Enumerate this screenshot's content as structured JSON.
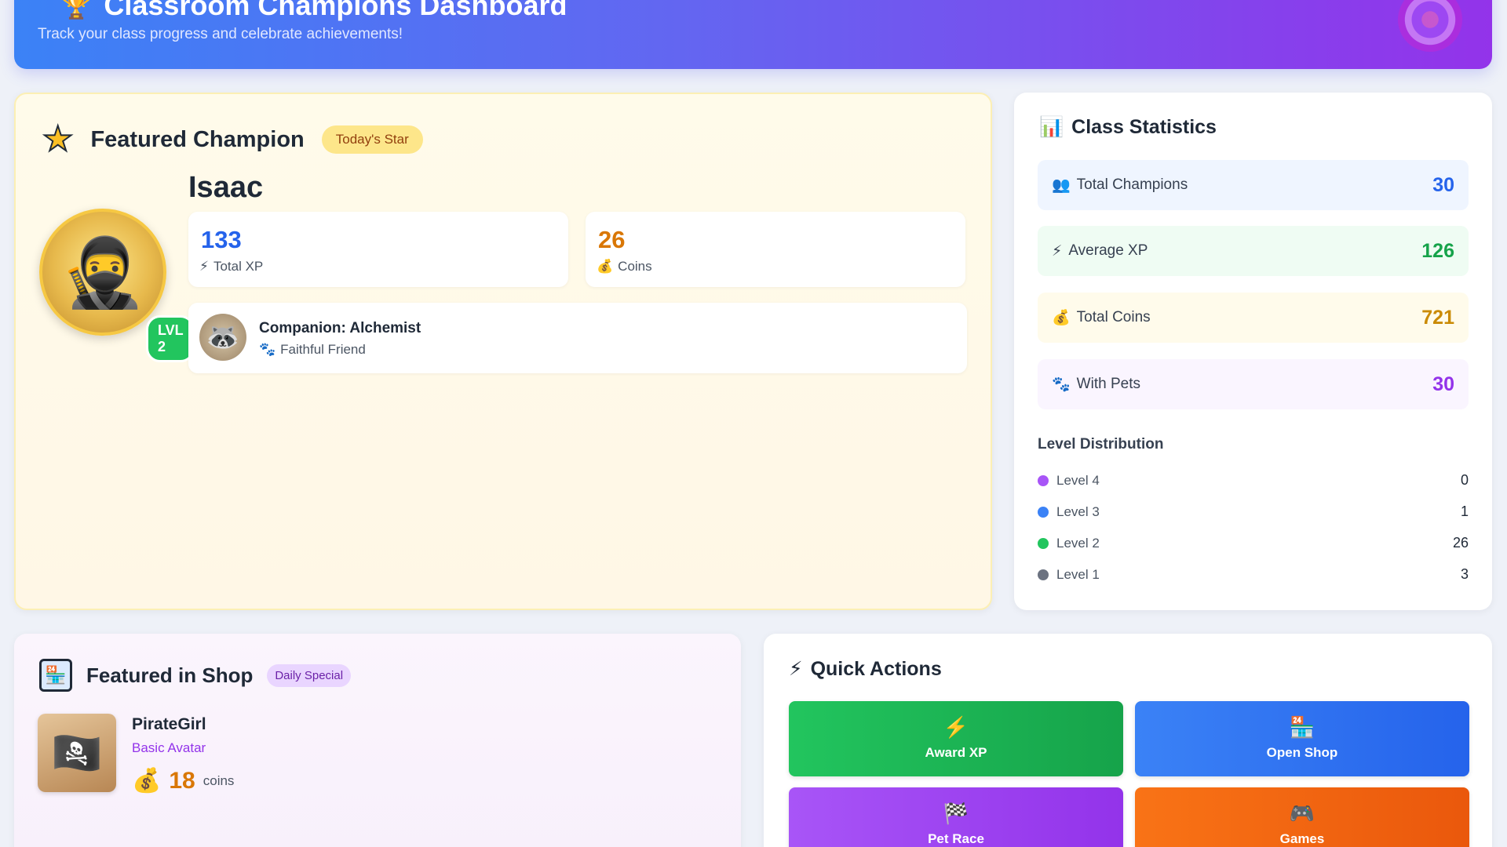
{
  "header": {
    "title": "Classroom Champions Dashboard",
    "subtitle": "Track your class progress and celebrate achievements!",
    "trophy_icon": "🏆"
  },
  "featured_champion": {
    "title": "Featured Champion",
    "badge": "Today's Star",
    "name": "Isaac",
    "level_badge": "LVL 2",
    "avatar_glyph": "🥷",
    "xp_value": "133",
    "xp_label": "Total XP",
    "coins_value": "26",
    "coins_label": "Coins",
    "companion_title": "Companion: Alchemist",
    "companion_sub": "Faithful Friend",
    "companion_glyph": "🦝"
  },
  "class_statistics": {
    "title": "Class Statistics",
    "rows": [
      {
        "label": "Total Champions",
        "value": "30",
        "icon": "👥"
      },
      {
        "label": "Average XP",
        "value": "126",
        "icon": "⚡"
      },
      {
        "label": "Total Coins",
        "value": "721",
        "icon": "💰"
      },
      {
        "label": "With Pets",
        "value": "30",
        "icon": "🐾"
      }
    ],
    "level_distribution_title": "Level Distribution",
    "levels": [
      {
        "label": "Level 4",
        "count": "0",
        "color": "#a855f7"
      },
      {
        "label": "Level 3",
        "count": "1",
        "color": "#3b82f6"
      },
      {
        "label": "Level 2",
        "count": "26",
        "color": "#22c55e"
      },
      {
        "label": "Level 1",
        "count": "3",
        "color": "#6b7280"
      }
    ]
  },
  "shop": {
    "title": "Featured in Shop",
    "badge": "Daily Special",
    "item_name": "PirateGirl",
    "item_type": "Basic Avatar",
    "price": "18",
    "price_unit": "coins",
    "item_glyph": "🏴‍☠️"
  },
  "quick_actions": {
    "title": "Quick Actions",
    "buttons": [
      {
        "label": "Award XP",
        "icon": "⚡"
      },
      {
        "label": "Open Shop",
        "icon": "🏪"
      },
      {
        "label": "Pet Race",
        "icon": "🏁"
      },
      {
        "label": "Games",
        "icon": "🎮"
      }
    ]
  }
}
